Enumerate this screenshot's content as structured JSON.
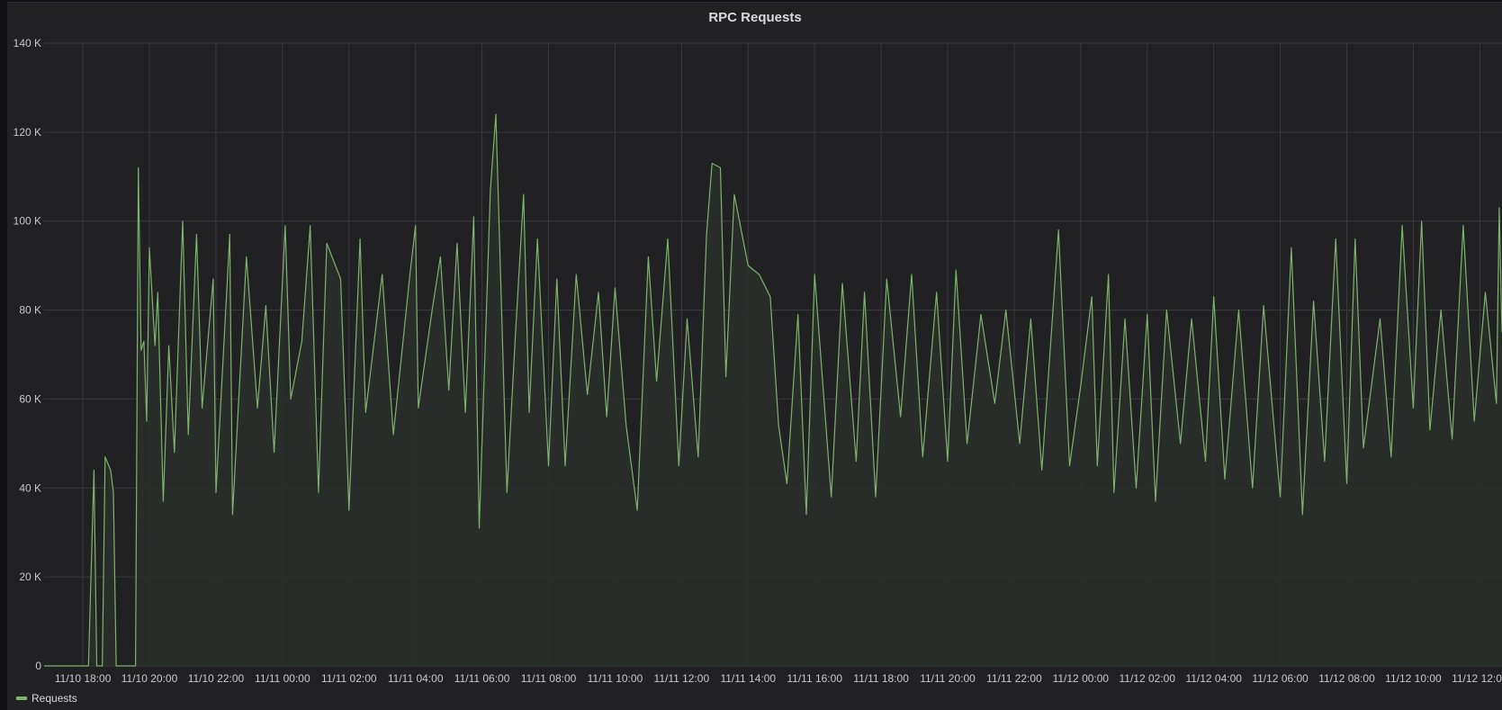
{
  "panel": {
    "title": "RPC Requests"
  },
  "colors": {
    "series": "#7eb26d",
    "fill": "#2a2f2a",
    "grid": "#3a3b3f"
  },
  "chart_data": {
    "type": "area",
    "title": "RPC Requests",
    "xlabel": "",
    "ylabel": "",
    "ylim": [
      0,
      140000
    ],
    "xlim": [
      "2021-11-10 16:50",
      "2021-11-12 12:40"
    ],
    "grid": true,
    "legend_position": "bottom-left",
    "y_ticks": [
      0,
      20000,
      40000,
      60000,
      80000,
      100000,
      120000,
      140000
    ],
    "y_tick_labels": [
      "0",
      "20 K",
      "40 K",
      "60 K",
      "80 K",
      "100 K",
      "120 K",
      "140 K"
    ],
    "x_ticks": [
      "2021-11-10 18:00",
      "2021-11-10 20:00",
      "2021-11-10 22:00",
      "2021-11-11 00:00",
      "2021-11-11 02:00",
      "2021-11-11 04:00",
      "2021-11-11 06:00",
      "2021-11-11 08:00",
      "2021-11-11 10:00",
      "2021-11-11 12:00",
      "2021-11-11 14:00",
      "2021-11-11 16:00",
      "2021-11-11 18:00",
      "2021-11-11 20:00",
      "2021-11-11 22:00",
      "2021-11-12 00:00",
      "2021-11-12 02:00",
      "2021-11-12 04:00",
      "2021-11-12 06:00",
      "2021-11-12 08:00",
      "2021-11-12 10:00",
      "2021-11-12 12:00"
    ],
    "x_tick_labels": [
      "11/10 18:00",
      "11/10 20:00",
      "11/10 22:00",
      "11/11 00:00",
      "11/11 02:00",
      "11/11 04:00",
      "11/11 06:00",
      "11/11 08:00",
      "11/11 10:00",
      "11/11 12:00",
      "11/11 14:00",
      "11/11 16:00",
      "11/11 18:00",
      "11/11 20:00",
      "11/11 22:00",
      "11/12 00:00",
      "11/12 02:00",
      "11/12 04:00",
      "11/12 06:00",
      "11/12 08:00",
      "11/12 10:00",
      "11/12 12:00"
    ],
    "series": [
      {
        "name": "Requests",
        "points": [
          [
            "2021-11-10 16:50",
            0
          ],
          [
            "2021-11-10 17:45",
            0
          ],
          [
            "2021-11-10 18:10",
            0
          ],
          [
            "2021-11-10 18:20",
            44000
          ],
          [
            "2021-11-10 18:25",
            0
          ],
          [
            "2021-11-10 18:35",
            0
          ],
          [
            "2021-11-10 18:40",
            47000
          ],
          [
            "2021-11-10 18:50",
            44000
          ],
          [
            "2021-11-10 18:55",
            39000
          ],
          [
            "2021-11-10 19:00",
            0
          ],
          [
            "2021-11-10 19:35",
            0
          ],
          [
            "2021-11-10 19:40",
            112000
          ],
          [
            "2021-11-10 19:45",
            71000
          ],
          [
            "2021-11-10 19:50",
            73000
          ],
          [
            "2021-11-10 19:55",
            55000
          ],
          [
            "2021-11-10 20:00",
            94000
          ],
          [
            "2021-11-10 20:10",
            72000
          ],
          [
            "2021-11-10 20:15",
            84000
          ],
          [
            "2021-11-10 20:25",
            37000
          ],
          [
            "2021-11-10 20:35",
            72000
          ],
          [
            "2021-11-10 20:45",
            48000
          ],
          [
            "2021-11-10 21:00",
            100000
          ],
          [
            "2021-11-10 21:10",
            52000
          ],
          [
            "2021-11-10 21:25",
            97000
          ],
          [
            "2021-11-10 21:35",
            58000
          ],
          [
            "2021-11-10 21:55",
            87000
          ],
          [
            "2021-11-10 22:00",
            39000
          ],
          [
            "2021-11-10 22:25",
            97000
          ],
          [
            "2021-11-10 22:30",
            34000
          ],
          [
            "2021-11-10 22:55",
            92000
          ],
          [
            "2021-11-10 23:15",
            58000
          ],
          [
            "2021-11-10 23:30",
            81000
          ],
          [
            "2021-11-10 23:45",
            48000
          ],
          [
            "2021-11-11 00:05",
            99000
          ],
          [
            "2021-11-11 00:15",
            60000
          ],
          [
            "2021-11-11 00:35",
            73000
          ],
          [
            "2021-11-11 00:50",
            99000
          ],
          [
            "2021-11-11 01:05",
            39000
          ],
          [
            "2021-11-11 01:20",
            95000
          ],
          [
            "2021-11-11 01:45",
            87000
          ],
          [
            "2021-11-11 02:00",
            35000
          ],
          [
            "2021-11-11 02:20",
            96000
          ],
          [
            "2021-11-11 02:30",
            57000
          ],
          [
            "2021-11-11 03:00",
            88000
          ],
          [
            "2021-11-11 03:20",
            52000
          ],
          [
            "2021-11-11 03:50",
            88000
          ],
          [
            "2021-11-11 04:00",
            99000
          ],
          [
            "2021-11-11 04:05",
            58000
          ],
          [
            "2021-11-11 04:30",
            80000
          ],
          [
            "2021-11-11 04:45",
            92000
          ],
          [
            "2021-11-11 05:00",
            62000
          ],
          [
            "2021-11-11 05:15",
            95000
          ],
          [
            "2021-11-11 05:30",
            57000
          ],
          [
            "2021-11-11 05:45",
            101000
          ],
          [
            "2021-11-11 05:55",
            31000
          ],
          [
            "2021-11-11 06:15",
            107000
          ],
          [
            "2021-11-11 06:25",
            124000
          ],
          [
            "2021-11-11 06:45",
            39000
          ],
          [
            "2021-11-11 07:00",
            74000
          ],
          [
            "2021-11-11 07:15",
            106000
          ],
          [
            "2021-11-11 07:25",
            57000
          ],
          [
            "2021-11-11 07:40",
            96000
          ],
          [
            "2021-11-11 08:00",
            45000
          ],
          [
            "2021-11-11 08:15",
            87000
          ],
          [
            "2021-11-11 08:30",
            45000
          ],
          [
            "2021-11-11 08:50",
            88000
          ],
          [
            "2021-11-11 09:10",
            61000
          ],
          [
            "2021-11-11 09:30",
            84000
          ],
          [
            "2021-11-11 09:45",
            56000
          ],
          [
            "2021-11-11 10:00",
            85000
          ],
          [
            "2021-11-11 10:20",
            54000
          ],
          [
            "2021-11-11 10:40",
            35000
          ],
          [
            "2021-11-11 11:00",
            92000
          ],
          [
            "2021-11-11 11:15",
            64000
          ],
          [
            "2021-11-11 11:35",
            96000
          ],
          [
            "2021-11-11 11:55",
            45000
          ],
          [
            "2021-11-11 12:10",
            78000
          ],
          [
            "2021-11-11 12:30",
            47000
          ],
          [
            "2021-11-11 12:45",
            97000
          ],
          [
            "2021-11-11 12:55",
            113000
          ],
          [
            "2021-11-11 13:10",
            112000
          ],
          [
            "2021-11-11 13:20",
            65000
          ],
          [
            "2021-11-11 13:35",
            106000
          ],
          [
            "2021-11-11 14:00",
            90000
          ],
          [
            "2021-11-11 14:20",
            88000
          ],
          [
            "2021-11-11 14:40",
            83000
          ],
          [
            "2021-11-11 14:55",
            54000
          ],
          [
            "2021-11-11 15:10",
            41000
          ],
          [
            "2021-11-11 15:30",
            79000
          ],
          [
            "2021-11-11 15:45",
            34000
          ],
          [
            "2021-11-11 16:00",
            88000
          ],
          [
            "2021-11-11 16:30",
            38000
          ],
          [
            "2021-11-11 16:50",
            86000
          ],
          [
            "2021-11-11 17:15",
            46000
          ],
          [
            "2021-11-11 17:30",
            84000
          ],
          [
            "2021-11-11 17:50",
            38000
          ],
          [
            "2021-11-11 18:10",
            87000
          ],
          [
            "2021-11-11 18:35",
            56000
          ],
          [
            "2021-11-11 18:55",
            88000
          ],
          [
            "2021-11-11 19:15",
            47000
          ],
          [
            "2021-11-11 19:40",
            84000
          ],
          [
            "2021-11-11 20:00",
            46000
          ],
          [
            "2021-11-11 20:15",
            89000
          ],
          [
            "2021-11-11 20:35",
            50000
          ],
          [
            "2021-11-11 21:00",
            79000
          ],
          [
            "2021-11-11 21:25",
            59000
          ],
          [
            "2021-11-11 21:45",
            80000
          ],
          [
            "2021-11-11 22:10",
            50000
          ],
          [
            "2021-11-11 22:30",
            78000
          ],
          [
            "2021-11-11 22:50",
            44000
          ],
          [
            "2021-11-11 23:20",
            98000
          ],
          [
            "2021-11-11 23:40",
            45000
          ],
          [
            "2021-11-12 00:00",
            63000
          ],
          [
            "2021-11-12 00:20",
            83000
          ],
          [
            "2021-11-12 00:30",
            45000
          ],
          [
            "2021-11-12 00:50",
            88000
          ],
          [
            "2021-11-12 01:00",
            39000
          ],
          [
            "2021-11-12 01:20",
            78000
          ],
          [
            "2021-11-12 01:40",
            40000
          ],
          [
            "2021-11-12 02:00",
            79000
          ],
          [
            "2021-11-12 02:15",
            37000
          ],
          [
            "2021-11-12 02:35",
            80000
          ],
          [
            "2021-11-12 03:00",
            50000
          ],
          [
            "2021-11-12 03:20",
            78000
          ],
          [
            "2021-11-12 03:45",
            46000
          ],
          [
            "2021-11-12 04:00",
            83000
          ],
          [
            "2021-11-12 04:20",
            42000
          ],
          [
            "2021-11-12 04:45",
            80000
          ],
          [
            "2021-11-12 05:10",
            40000
          ],
          [
            "2021-11-12 05:30",
            81000
          ],
          [
            "2021-11-12 05:50",
            52000
          ],
          [
            "2021-11-12 06:00",
            38000
          ],
          [
            "2021-11-12 06:20",
            94000
          ],
          [
            "2021-11-12 06:40",
            34000
          ],
          [
            "2021-11-12 07:00",
            82000
          ],
          [
            "2021-11-12 07:20",
            46000
          ],
          [
            "2021-11-12 07:40",
            96000
          ],
          [
            "2021-11-12 08:00",
            41000
          ],
          [
            "2021-11-12 08:15",
            96000
          ],
          [
            "2021-11-12 08:30",
            49000
          ],
          [
            "2021-11-12 09:00",
            78000
          ],
          [
            "2021-11-12 09:20",
            47000
          ],
          [
            "2021-11-12 09:40",
            99000
          ],
          [
            "2021-11-12 10:00",
            58000
          ],
          [
            "2021-11-12 10:15",
            100000
          ],
          [
            "2021-11-12 10:30",
            53000
          ],
          [
            "2021-11-12 10:50",
            80000
          ],
          [
            "2021-11-12 11:10",
            51000
          ],
          [
            "2021-11-12 11:30",
            99000
          ],
          [
            "2021-11-12 11:50",
            55000
          ],
          [
            "2021-11-12 12:10",
            84000
          ],
          [
            "2021-11-12 12:30",
            59000
          ],
          [
            "2021-11-12 12:35",
            103000
          ],
          [
            "2021-11-12 12:40",
            75000
          ]
        ]
      }
    ]
  },
  "legend": {
    "items": [
      {
        "label": "Requests"
      }
    ]
  }
}
